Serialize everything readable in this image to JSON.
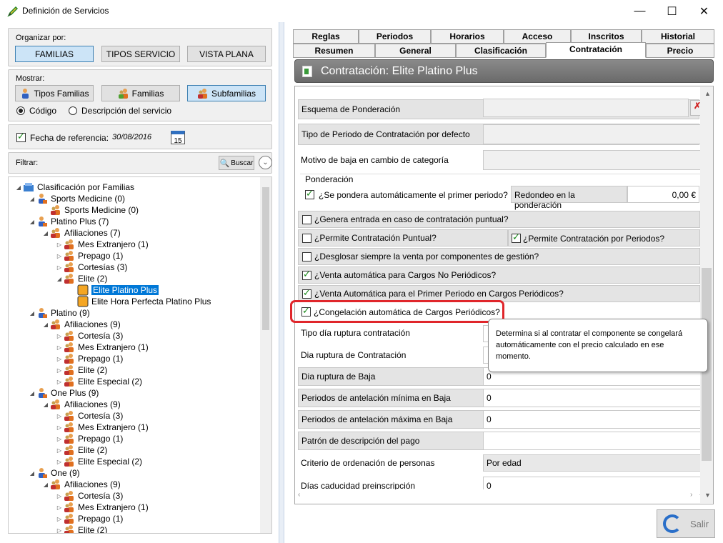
{
  "window": {
    "title": "Definición de Servicios"
  },
  "organize": {
    "label": "Organizar por:",
    "buttons": [
      "FAMILIAS",
      "TIPOS SERVICIO",
      "VISTA PLANA"
    ]
  },
  "show": {
    "label": "Mostrar:",
    "buttons": [
      "Tipos Familias",
      "Familias",
      "Subfamilias"
    ],
    "radio_code": "Código",
    "radio_desc": "Descripción del servicio"
  },
  "refdate": {
    "label": "Fecha de referencia:",
    "value": "30/08/2016",
    "cal": "15"
  },
  "filter": {
    "label": "Filtrar:",
    "search": "Buscar"
  },
  "tree": [
    {
      "text": "Clasificación por Familias",
      "lvl": 0,
      "arrow": "◢",
      "icon": "root"
    },
    {
      "text": "Sports Medicine (0)",
      "lvl": 1,
      "arrow": "◢",
      "icon": "person"
    },
    {
      "text": "Sports Medicine (0)",
      "lvl": 2,
      "arrow": "",
      "icon": "group"
    },
    {
      "text": "Platino Plus (7)",
      "lvl": 1,
      "arrow": "◢",
      "icon": "person"
    },
    {
      "text": "Afiliaciones (7)",
      "lvl": 2,
      "arrow": "◢",
      "icon": "group"
    },
    {
      "text": "Mes Extranjero (1)",
      "lvl": 3,
      "arrow": "▷",
      "icon": "group"
    },
    {
      "text": "Prepago (1)",
      "lvl": 3,
      "arrow": "▷",
      "icon": "group"
    },
    {
      "text": "Cortesías (3)",
      "lvl": 3,
      "arrow": "▷",
      "icon": "group"
    },
    {
      "text": "Elite (2)",
      "lvl": 3,
      "arrow": "◢",
      "icon": "group"
    },
    {
      "text": "Elite Platino Plus",
      "lvl": 4,
      "arrow": "",
      "icon": "orange",
      "sel": true
    },
    {
      "text": "Elite Hora Perfecta Platino Plus",
      "lvl": 4,
      "arrow": "",
      "icon": "orange"
    },
    {
      "text": "Platino (9)",
      "lvl": 1,
      "arrow": "◢",
      "icon": "person"
    },
    {
      "text": "Afiliaciones (9)",
      "lvl": 2,
      "arrow": "◢",
      "icon": "group"
    },
    {
      "text": "Cortesía (3)",
      "lvl": 3,
      "arrow": "▷",
      "icon": "group"
    },
    {
      "text": "Mes Extranjero (1)",
      "lvl": 3,
      "arrow": "▷",
      "icon": "group"
    },
    {
      "text": "Prepago (1)",
      "lvl": 3,
      "arrow": "▷",
      "icon": "group"
    },
    {
      "text": "Elite (2)",
      "lvl": 3,
      "arrow": "▷",
      "icon": "group"
    },
    {
      "text": "Elite Especial (2)",
      "lvl": 3,
      "arrow": "▷",
      "icon": "group"
    },
    {
      "text": "One Plus (9)",
      "lvl": 1,
      "arrow": "◢",
      "icon": "person"
    },
    {
      "text": "Afiliaciones (9)",
      "lvl": 2,
      "arrow": "◢",
      "icon": "group"
    },
    {
      "text": "Cortesía (3)",
      "lvl": 3,
      "arrow": "▷",
      "icon": "group"
    },
    {
      "text": "Mes Extranjero (1)",
      "lvl": 3,
      "arrow": "▷",
      "icon": "group"
    },
    {
      "text": "Prepago (1)",
      "lvl": 3,
      "arrow": "▷",
      "icon": "group"
    },
    {
      "text": "Elite (2)",
      "lvl": 3,
      "arrow": "▷",
      "icon": "group"
    },
    {
      "text": "Elite Especial (2)",
      "lvl": 3,
      "arrow": "▷",
      "icon": "group"
    },
    {
      "text": "One (9)",
      "lvl": 1,
      "arrow": "◢",
      "icon": "person"
    },
    {
      "text": "Afiliaciones (9)",
      "lvl": 2,
      "arrow": "◢",
      "icon": "group"
    },
    {
      "text": "Cortesía (3)",
      "lvl": 3,
      "arrow": "▷",
      "icon": "group"
    },
    {
      "text": "Mes Extranjero (1)",
      "lvl": 3,
      "arrow": "▷",
      "icon": "group"
    },
    {
      "text": "Prepago (1)",
      "lvl": 3,
      "arrow": "▷",
      "icon": "group"
    },
    {
      "text": "Elite (2)",
      "lvl": 3,
      "arrow": "▷",
      "icon": "group"
    }
  ],
  "tabs_top": [
    "Reglas",
    "Periodos",
    "Horarios",
    "Acceso",
    "Inscritos",
    "Historial"
  ],
  "tabs_bottom": [
    "Resumen",
    "General",
    "Clasificación",
    "Contratación",
    "Precio"
  ],
  "header": "Contratación: Elite Platino Plus",
  "form": {
    "esquema": "Esquema de Ponderación",
    "tipo_periodo": "Tipo de Periodo de Contratación por defecto",
    "motivo_baja": "Motivo de baja en cambio de categoría",
    "ponderacion_group": "Ponderación",
    "pondera_auto": "¿Se pondera automáticamente el primer periodo?",
    "redondeo": "Redondeo en la ponderación",
    "redondeo_value": "0,00 €",
    "genera_entrada": "¿Genera entrada en caso de contratación puntual?",
    "permite_puntual": "¿Permite Contratación Puntual?",
    "permite_periodos": "¿Permite Contratación por Periodos?",
    "desglosar": "¿Desglosar siempre la venta por componentes de gestión?",
    "venta_no_periodicos": "¿Venta automática para Cargos No Periódicos?",
    "venta_primer_periodo": "¿Venta Automática para el Primer Periodo en Cargos Periódicos?",
    "congelacion": "¿Congelación automática de Cargos Periódicos?",
    "tipo_dia_ruptura": "Tipo día ruptura contratación",
    "dia_ruptura_contr": "Dia ruptura de Contratación",
    "dia_ruptura_baja": "Dia ruptura de Baja",
    "dia_ruptura_baja_v": "0",
    "ant_min": "Periodos de antelación mínima en Baja",
    "ant_min_v": "0",
    "ant_max": "Periodos de antelación máxima en Baja",
    "ant_max_v": "0",
    "patron": "Patrón de descripción del pago",
    "criterio": "Criterio de ordenación de personas",
    "criterio_v": "Por edad",
    "dias_cad": "Días caducidad preinscripción",
    "dias_cad_v": "0"
  },
  "tooltip": "Determina si al contratar el componente se congelará automáticamente con el precio calculado en ese momento.",
  "salir": "Salir"
}
